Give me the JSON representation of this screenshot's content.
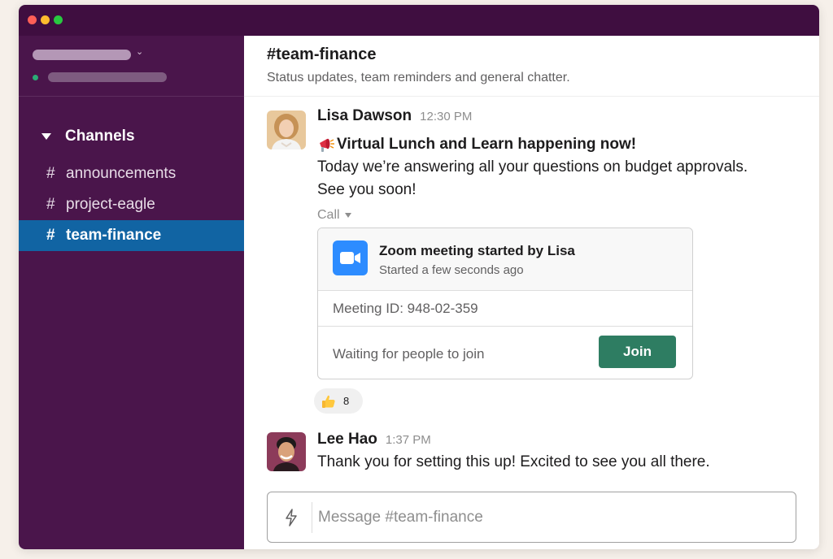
{
  "sidebar": {
    "channels_header": "Channels",
    "channels": [
      {
        "label": "announcements"
      },
      {
        "label": "project-eagle"
      },
      {
        "label": "team-finance"
      }
    ]
  },
  "header": {
    "title": "#team-finance",
    "topic": "Status updates, team reminders and general chatter."
  },
  "messages": [
    {
      "author": "Lisa Dawson",
      "time": "12:30 PM",
      "lines": [
        "Virtual Lunch and Learn happening now!",
        "Today we’re answering all your questions on budget approvals.",
        "See you soon!"
      ]
    },
    {
      "author": "Lee Hao",
      "time": "1:37 PM",
      "lines": [
        "Thank you for setting this up! Excited to see you all there."
      ]
    }
  ],
  "call": {
    "label": "Call",
    "title": "Zoom meeting started by Lisa",
    "subtitle": "Started a few seconds ago",
    "meeting_id": "Meeting ID: 948-02-359",
    "waiting": "Waiting for people to join",
    "join_label": "Join"
  },
  "reaction": {
    "emoji": "thumbs-up-icon",
    "count": "8"
  },
  "composer": {
    "placeholder": "Message #team-finance"
  },
  "colors": {
    "sidebar_bg": "#4a154b",
    "titlebar_bg": "#3f0e40",
    "active_channel": "#1164a3",
    "join_button": "#2e7d62",
    "zoom_blue": "#2d8cff"
  }
}
